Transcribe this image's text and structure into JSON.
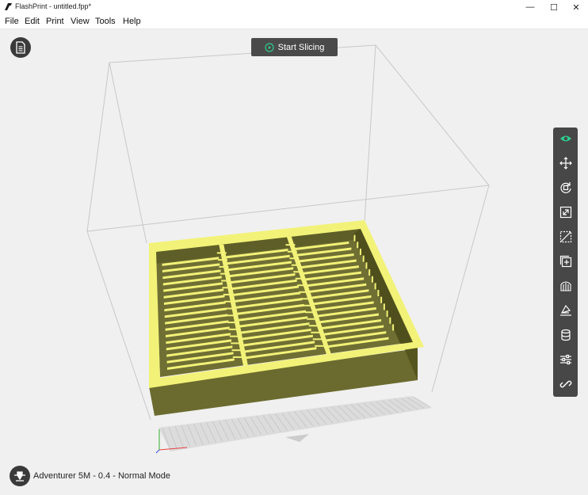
{
  "window": {
    "title": "FlashPrint - untitled.fpp*",
    "minimize_glyph": "—",
    "maximize_glyph": "☐",
    "close_glyph": "✕"
  },
  "menu": {
    "items": [
      {
        "label": "File"
      },
      {
        "label": "Edit"
      },
      {
        "label": "Print"
      },
      {
        "label": "View"
      },
      {
        "label": "Tools"
      },
      {
        "label": "Help"
      }
    ]
  },
  "actions": {
    "start_slicing_label": "Start Slicing"
  },
  "toolbar": {
    "tools": [
      {
        "icon": "eye-icon",
        "active": true
      },
      {
        "icon": "move-icon"
      },
      {
        "icon": "rotate-icon"
      },
      {
        "icon": "scale-icon"
      },
      {
        "icon": "cut-icon"
      },
      {
        "icon": "add-object-icon"
      },
      {
        "icon": "supports-icon"
      },
      {
        "icon": "lay-flat-icon"
      },
      {
        "icon": "cylinder-icon"
      },
      {
        "icon": "settings-sliders-icon"
      },
      {
        "icon": "link-icon"
      }
    ]
  },
  "status": {
    "printer_label": "Adventurer 5M - 0.4 - Normal Mode"
  },
  "colors": {
    "accent": "#2ecc8f",
    "model_fill": "#6b6b2f",
    "model_highlight": "#f2f278",
    "toolbar_bg": "#474747"
  }
}
